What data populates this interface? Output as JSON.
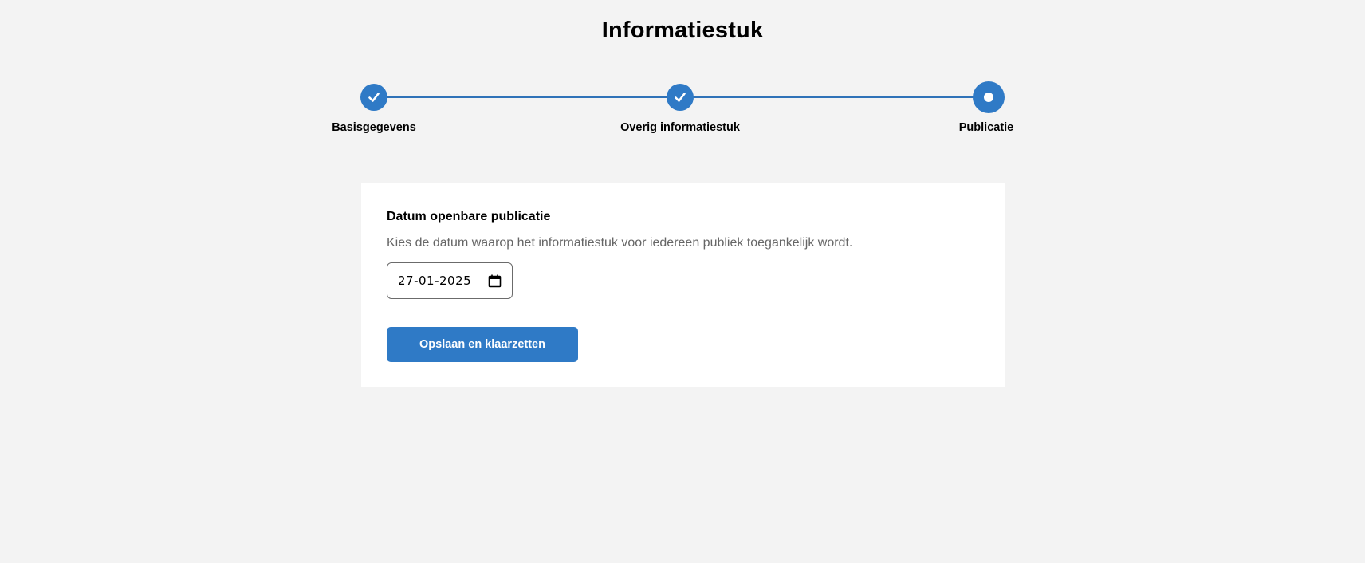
{
  "page": {
    "title": "Informatiestuk"
  },
  "stepper": {
    "steps": [
      {
        "label": "Basisgegevens",
        "state": "completed",
        "icon": "check-icon"
      },
      {
        "label": "Overig informatiestuk",
        "state": "completed",
        "icon": "check-icon"
      },
      {
        "label": "Publicatie",
        "state": "current",
        "icon": "dot-icon"
      }
    ]
  },
  "form": {
    "label": "Datum openbare publicatie",
    "hint": "Kies de datum waarop het informatiestuk voor iedereen publiek toegankelijk wordt.",
    "date_value": "27-01-2025",
    "submit_label": "Opslaan en klaarzetten"
  },
  "colors": {
    "accent": "#2f7ac6",
    "background": "#f3f3f3",
    "card": "#ffffff",
    "hint_text": "#666666"
  }
}
